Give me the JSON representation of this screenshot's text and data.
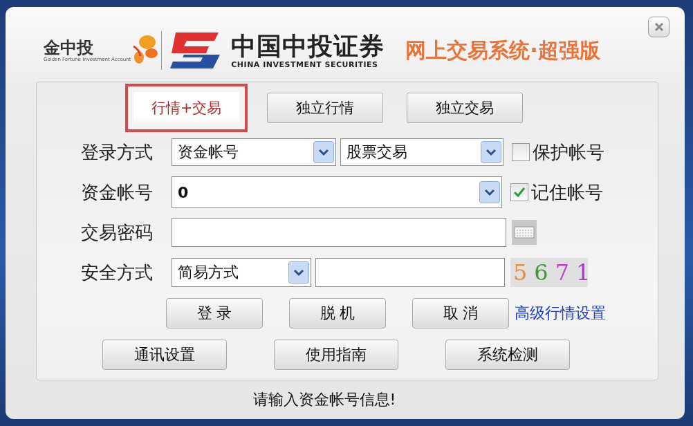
{
  "brand": {
    "partner_name": "金中投",
    "partner_tagline": "Golden Fortune Investment Account",
    "company_name": "中国中投证券",
    "company_english": "CHINA INVESTMENT SECURITIES",
    "product": "网上交易系统·超强版"
  },
  "modes": [
    {
      "label": "行情+交易",
      "selected": true
    },
    {
      "label": "独立行情",
      "selected": false
    },
    {
      "label": "独立交易",
      "selected": false
    }
  ],
  "login_type": {
    "label": "登录方式",
    "account_type": "资金帐号",
    "trade_type": "股票交易",
    "protect_account": {
      "label": "保护帐号",
      "checked": false
    }
  },
  "account": {
    "label": "资金帐号",
    "value": "0",
    "remember": {
      "label": "记住帐号",
      "checked": true
    }
  },
  "password": {
    "label": "交易密码"
  },
  "security": {
    "label": "安全方式",
    "method": "简易方式",
    "captcha": [
      {
        "text": "5",
        "color": "#e0903a"
      },
      {
        "text": "6",
        "color": "#3a9a3a"
      },
      {
        "text": "7",
        "color": "#c040d0"
      },
      {
        "text": "1",
        "color": "#a040c0"
      }
    ]
  },
  "actions": [
    {
      "label": "登 录"
    },
    {
      "label": "脱 机"
    },
    {
      "label": "取 消"
    }
  ],
  "advanced_link": "高级行情设置",
  "tools": [
    {
      "label": "通讯设置"
    },
    {
      "label": "使用指南"
    },
    {
      "label": "系统检测"
    }
  ],
  "status": "请输入资金帐号信息!"
}
